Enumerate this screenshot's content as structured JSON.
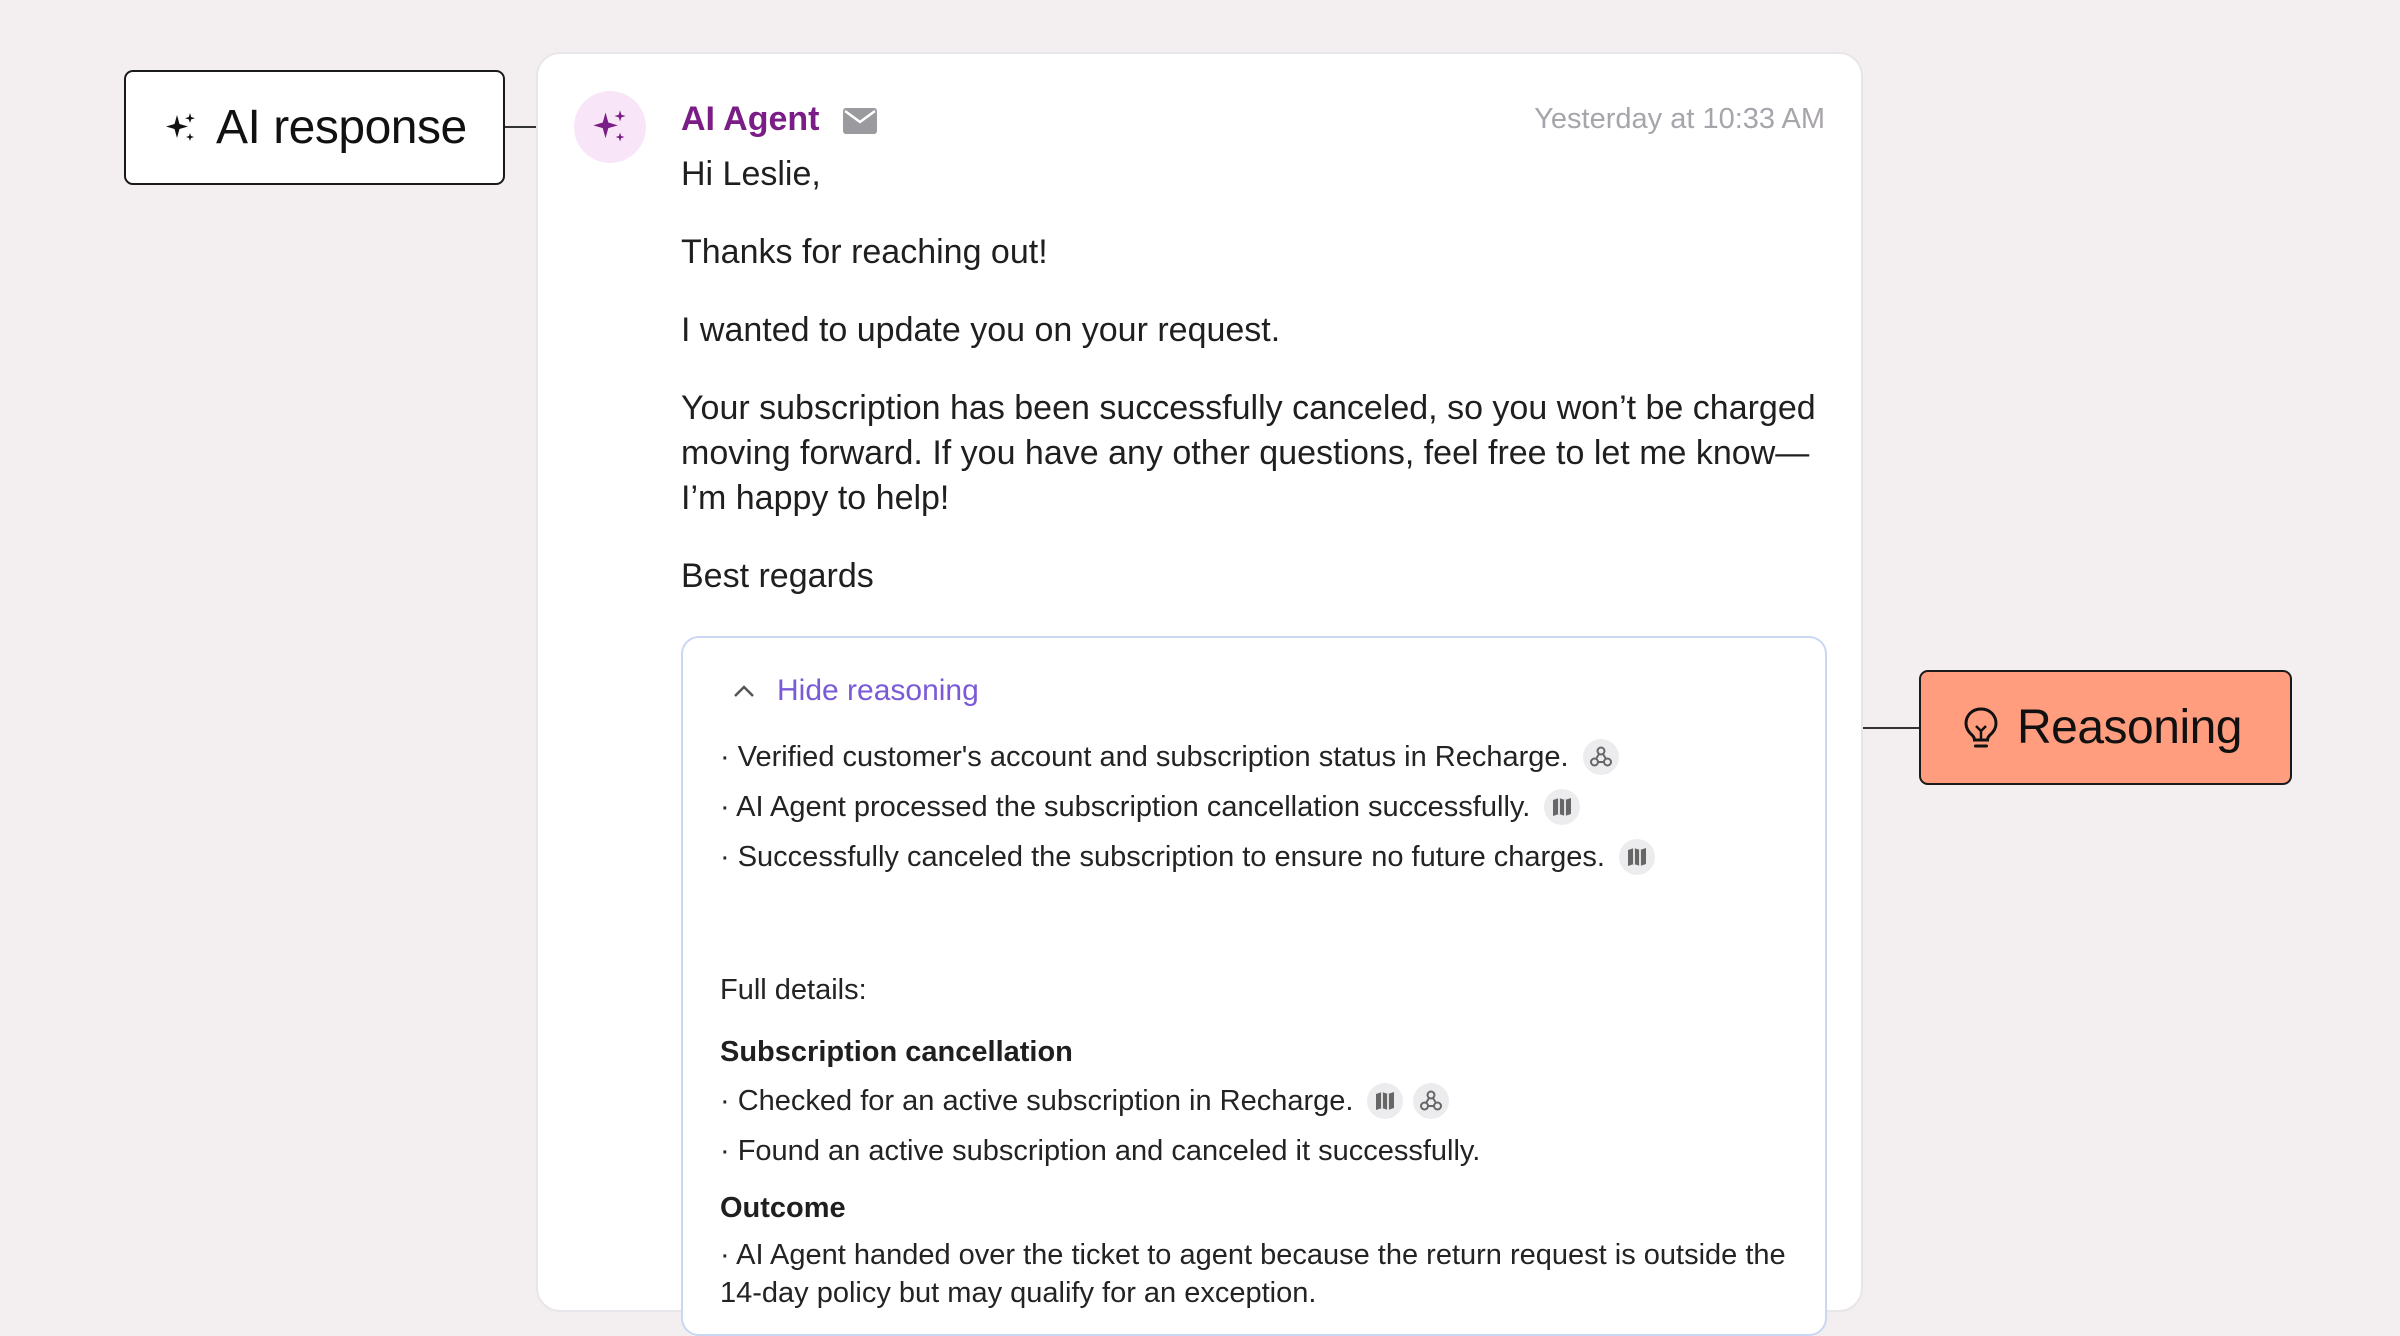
{
  "callouts": {
    "ai_response": "AI response",
    "reasoning": "Reasoning"
  },
  "message": {
    "agent_name": "AI Agent",
    "timestamp": "Yesterday at 10:33 AM",
    "paragraphs": [
      "Hi Leslie,",
      "Thanks for reaching out!",
      "I wanted to update you on your request.",
      "Your subscription has been successfully canceled, so you won’t be charged moving forward. If you have any other questions, feel free to let me know—I’m happy to help!",
      "Best regards"
    ]
  },
  "reasoning": {
    "toggle_label": "Hide reasoning",
    "summary": [
      {
        "text": "· Verified customer's account and subscription status in Recharge.",
        "icons": [
          "webhook-icon"
        ]
      },
      {
        "text": "· AI Agent processed the subscription cancellation successfully.",
        "icons": [
          "map-icon"
        ]
      },
      {
        "text": "· Successfully canceled the subscription to ensure no future charges.",
        "icons": [
          "map-icon"
        ]
      }
    ],
    "full_details_label": "Full details:",
    "sections": [
      {
        "title": "Subscription cancellation",
        "items": [
          {
            "text": "· Checked for an active subscription in Recharge.",
            "icons": [
              "map-icon",
              "webhook-icon"
            ]
          },
          {
            "text": "· Found an active subscription and canceled it successfully.",
            "icons": []
          }
        ]
      },
      {
        "title": "Outcome",
        "items": [
          {
            "text": "· AI Agent handed over the ticket to agent because the return request is outside the 14-day policy but may qualify for an exception.",
            "icons": []
          }
        ]
      }
    ]
  },
  "colors": {
    "agent_name": "#7b1d86",
    "reasoning_callout": "#ff9d7e",
    "toggle_label": "#7a5ad6"
  }
}
